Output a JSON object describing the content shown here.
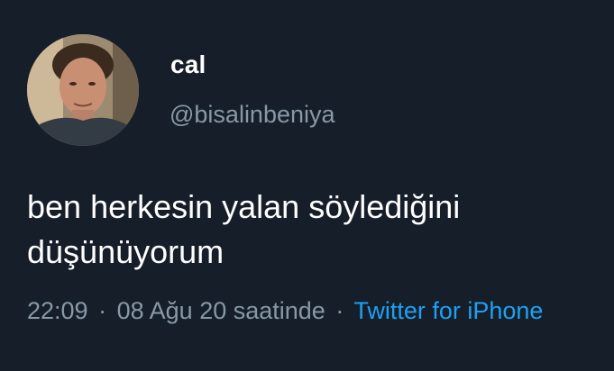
{
  "tweet": {
    "display_name": "cal",
    "handle": "@bisalinbeniya",
    "text_line1": "ben herkesin yalan söylediğini",
    "text_line2": "düşünüyorum",
    "time": "22:09",
    "separator": "·",
    "date_text": "08 Ağu 20 saatinde",
    "source": "Twitter for iPhone"
  },
  "colors": {
    "background": "#161e29",
    "text": "#ffffff",
    "secondary_text": "#8899a6",
    "link": "#1da1f2"
  },
  "icons": {
    "avatar": "profile-photo"
  }
}
